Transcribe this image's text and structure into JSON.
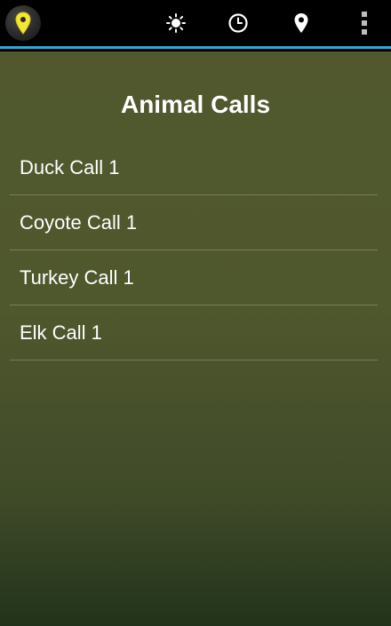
{
  "actionbar": {
    "accent_color": "#33a9d4",
    "logo_icon": "map-pin-icon",
    "actions": [
      {
        "icon": "sun-icon"
      },
      {
        "icon": "clock-icon"
      },
      {
        "icon": "location-pin-icon"
      },
      {
        "icon": "overflow-menu-icon"
      }
    ]
  },
  "main": {
    "title": "Animal Calls",
    "calls": [
      {
        "label": "Duck Call 1"
      },
      {
        "label": "Coyote Call 1"
      },
      {
        "label": "Turkey Call 1"
      },
      {
        "label": "Elk Call 1"
      }
    ]
  }
}
